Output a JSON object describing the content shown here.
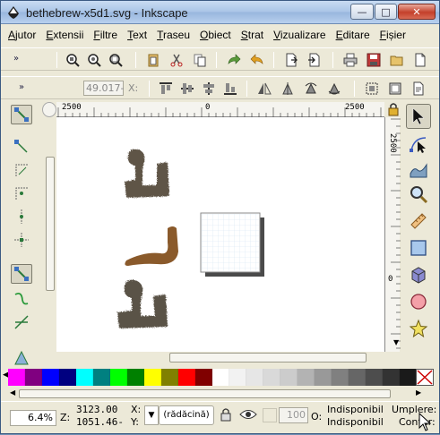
{
  "window": {
    "title": "bethebrew-x5d1.svg - Inkscape",
    "minimize_label": "—",
    "maximize_label": "□",
    "close_label": "✕"
  },
  "menu": [
    "Ajutor",
    "Extensii",
    "Filtre",
    "Text",
    "Traseu",
    "Obiect",
    "Strat",
    "Vizualizare",
    "Editare",
    "Fișier"
  ],
  "toolbar_commands": {
    "overflow_label": "»",
    "buttons": [
      "zoom-selection-icon",
      "zoom-drawing-icon",
      "zoom-page-icon",
      "paste-in-place-icon",
      "cut-icon",
      "copy-icon",
      "redo-icon",
      "undo-icon",
      "export-icon",
      "import-icon",
      "print-icon",
      "save-icon",
      "open-icon",
      "new-icon"
    ]
  },
  "toolbar_tool": {
    "overflow_label": "»",
    "x_value": "49.017-",
    "x_label": "X:"
  },
  "rulers": {
    "h_labels": [
      "2500",
      "0",
      "2500"
    ],
    "v_labels": [
      "2500",
      "0"
    ]
  },
  "left_tools": [
    "snap-enable-icon",
    "snap-bbox-icon",
    "snap-bbox-edge-icon",
    "snap-bbox-corner-icon",
    "snap-bbox-midpoint-icon",
    "snap-center-icon",
    "snap-nodes-icon",
    "snap-path-icon",
    "snap-intersection-icon",
    "snap-smooth-icon",
    "snap-guide-icon"
  ],
  "right_tools": [
    "selector-arrow-icon",
    "node-tool-icon",
    "tweak-tool-icon",
    "zoom-tool-icon",
    "measure-tool-icon",
    "rect-tool-icon",
    "3dbox-tool-icon",
    "ellipse-tool-icon",
    "star-tool-icon"
  ],
  "palette": {
    "colors": [
      "#ff00ff",
      "#800080",
      "#0000ff",
      "#000080",
      "#00ffff",
      "#008080",
      "#00ff00",
      "#008000",
      "#ffff00",
      "#808000",
      "#ff0000",
      "#800000",
      "#ffffff",
      "#f2f2f2",
      "#e6e6e6",
      "#d9d9d9",
      "#cccccc",
      "#b3b3b3",
      "#999999",
      "#808080",
      "#666666",
      "#4d4d4d",
      "#333333",
      "#1a1a1a",
      "#000000"
    ]
  },
  "status": {
    "zoom_value": "6.4%",
    "z_label": "Z:",
    "x_coord": "3123.00",
    "y_coord": "1051.46-",
    "x_label": "X:",
    "y_label": "Y:",
    "layer": "(rădăcină)",
    "opacity_value": "100",
    "o_label": "O:",
    "fill_status": "Indisponibil",
    "stroke_status": "Indisponibil",
    "fill_label": "Umplere:",
    "stroke_label": "Contur:"
  },
  "colors": {
    "brown_glyph": "#8a5a2b",
    "dark_glyph": "#5e5447",
    "page_shadow": "#4a4a4a"
  }
}
